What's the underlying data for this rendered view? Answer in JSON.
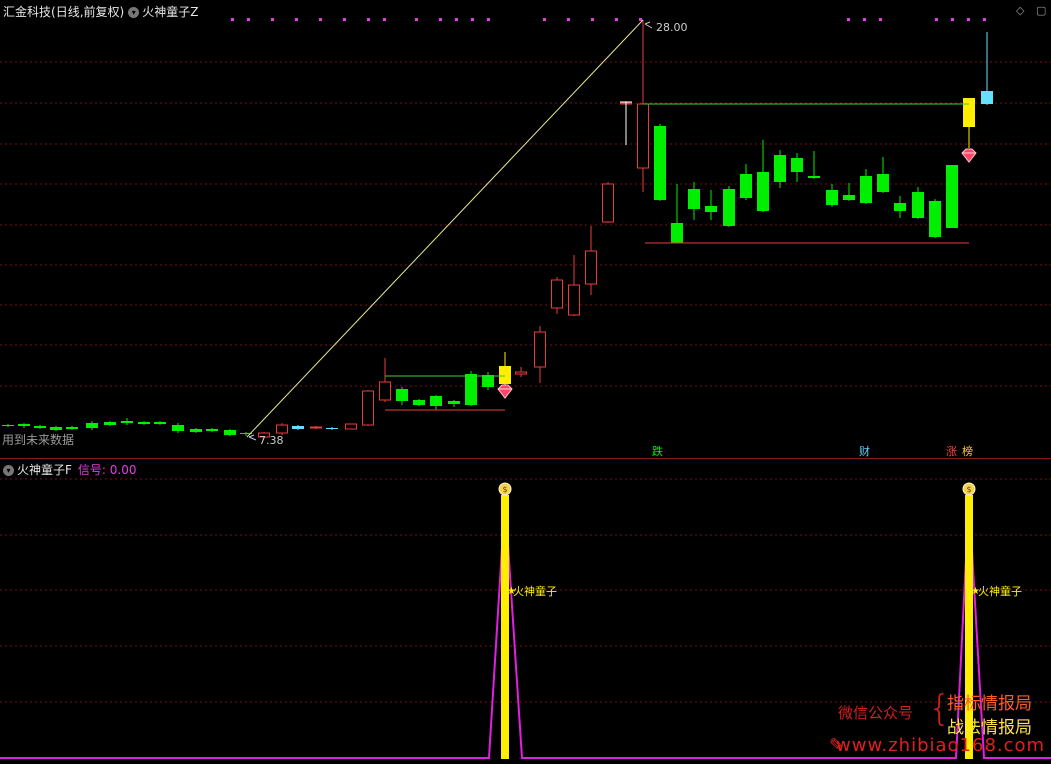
{
  "main_panel": {
    "stock_name": "汇金科技",
    "period_label": "(日线,前复权)",
    "indicator_name": "火神童子Z",
    "high_label": "28.00",
    "low_label": "7.38",
    "future_data_note": "用到未来数据",
    "event_tags": {
      "drop": "跌",
      "finance": "财",
      "rise": "涨",
      "rank": "榜"
    },
    "colors": {
      "up": "#e83b3b",
      "down": "#00ee00",
      "flat": "#66e0ff",
      "signal": "#ffee00",
      "grid": "#7a1010"
    }
  },
  "sub_panel": {
    "indicator_name": "火神童子F",
    "signal_label": "信号: 0.00",
    "marker_label": "火神童子",
    "marker_icon": "money-bag-icon",
    "colors": {
      "line": "#e020e0",
      "bar": "#ffee00"
    }
  },
  "watermark": {
    "wechat_label": "微信公众号",
    "account_1": "指标情报局",
    "account_2": "战法情报局",
    "website": "www.zhibiao168.com"
  }
}
